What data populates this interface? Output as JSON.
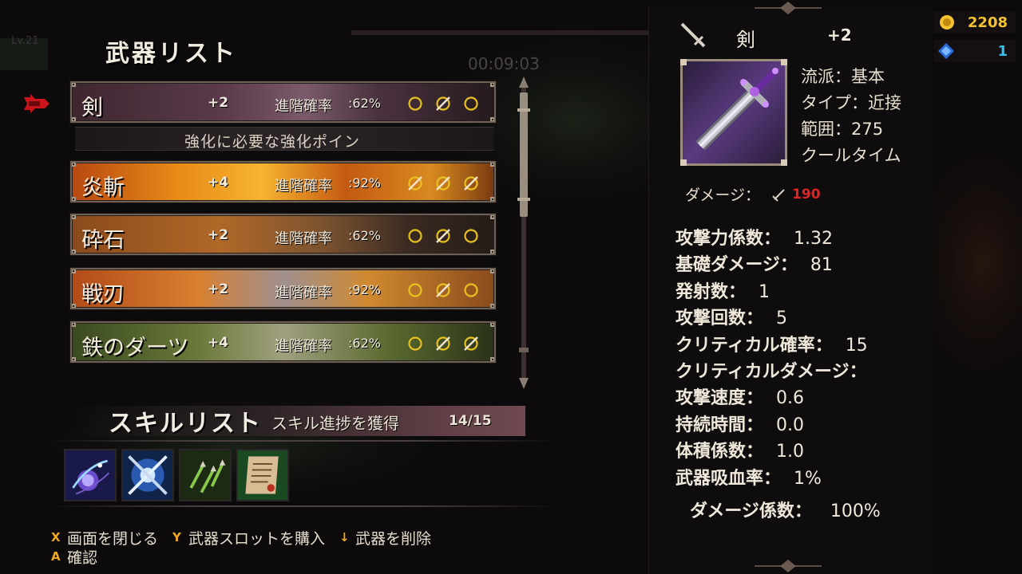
{
  "left_panel": {
    "title": "武器リスト",
    "weapons": [
      {
        "name": "剣",
        "level": "+2",
        "rate_label": "進階確率",
        "rate_value": ":62%",
        "slots": [
          "empty",
          "filled",
          "empty"
        ]
      },
      {
        "name": "炎斬",
        "level": "+4",
        "rate_label": "進階確率",
        "rate_value": ":92%",
        "slots": [
          "filled",
          "filled",
          "filled"
        ]
      },
      {
        "name": "砕石",
        "level": "+2",
        "rate_label": "進階確率",
        "rate_value": ":62%",
        "slots": [
          "empty",
          "filled",
          "empty"
        ]
      },
      {
        "name": "戦刃",
        "level": "+2",
        "rate_label": "進階確率",
        "rate_value": ":92%",
        "slots": [
          "empty",
          "filled",
          "empty"
        ]
      },
      {
        "name": "鉄のダーツ",
        "level": "+4",
        "rate_label": "進階確率",
        "rate_value": ":62%",
        "slots": [
          "empty",
          "filled",
          "filled"
        ]
      }
    ],
    "hint": "強化に必要な強化ポイン"
  },
  "skills": {
    "title": "スキルリスト",
    "subtitle": "スキル進捗を獲得",
    "progress": "14/15",
    "icons": [
      "magic-hand-skill-icon",
      "crossed-swords-skill-icon",
      "green-darts-skill-icon",
      "scroll-skill-icon"
    ]
  },
  "controls": [
    [
      {
        "key": "X",
        "action": "画面を閉じる"
      },
      {
        "key": "Y",
        "action": "武器スロットを購入"
      },
      {
        "key": "↓",
        "action": "武器を削除"
      }
    ],
    [
      {
        "key": "A",
        "action": "確認"
      }
    ]
  ],
  "detail": {
    "name": "剣",
    "level": "+2",
    "info": [
      "流派：基本",
      "タイプ：近接",
      "範囲：275",
      "クールタイム"
    ],
    "damage_label": "ダメージ：",
    "damage_value": "190",
    "stats": [
      {
        "label": "攻撃力係数：",
        "value": "1.32"
      },
      {
        "label": "基礎ダメージ：",
        "value": "81"
      },
      {
        "label": "発射数：",
        "value": "1"
      },
      {
        "label": "攻撃回数：",
        "value": "5"
      },
      {
        "label": "クリティカル確率：",
        "value": "15"
      },
      {
        "label": "クリティカルダメージ：",
        "value": ""
      },
      {
        "label": "攻撃速度：",
        "value": "0.6"
      },
      {
        "label": "持続時間：",
        "value": "0.0"
      },
      {
        "label": "体積係数：",
        "value": "1.0"
      },
      {
        "label": "武器吸血率：",
        "value": "1%"
      }
    ],
    "damage_coef_label": "ダメージ係数：",
    "damage_coef_value": "100%"
  },
  "currency": {
    "gold": "2208",
    "gems": "1"
  },
  "background": {
    "timer": "00:09:03",
    "level_tag": "Lv.21"
  },
  "colors": {
    "gold": "#f4c230",
    "gem": "#36c0e8",
    "damage": "#e02424",
    "key_hint": "#f0a820"
  }
}
